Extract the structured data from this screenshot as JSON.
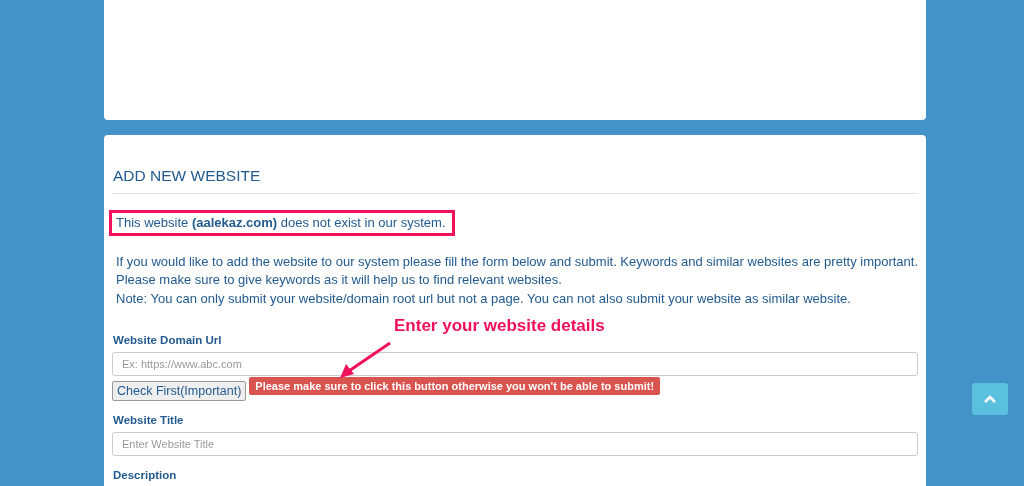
{
  "section": {
    "title": "ADD NEW WEBSITE",
    "notice": "This website **(aalekaz.com)** does not exist in our system.",
    "intro": [
      "If you would like to add the website to our system please fill the form below and submit. Keywords and similar websites are pretty important.",
      "Please make sure to give keywords as it will help us to find relevant websites.",
      "Note: You can only submit your website/domain root url but not a page. You can not also submit your website as similar website."
    ],
    "fields": [
      {
        "label": "Website Domain Url",
        "placeholder": "Ex: https://www.abc.com",
        "button": "Check First(Important)",
        "warning": "Please make sure to click this button otherwise you won't be able to submit!"
      },
      {
        "label": "Website Title",
        "placeholder": "Enter Website Title"
      },
      {
        "label": "Description"
      }
    ]
  },
  "annotation": {
    "text": "Enter your website details"
  }
}
